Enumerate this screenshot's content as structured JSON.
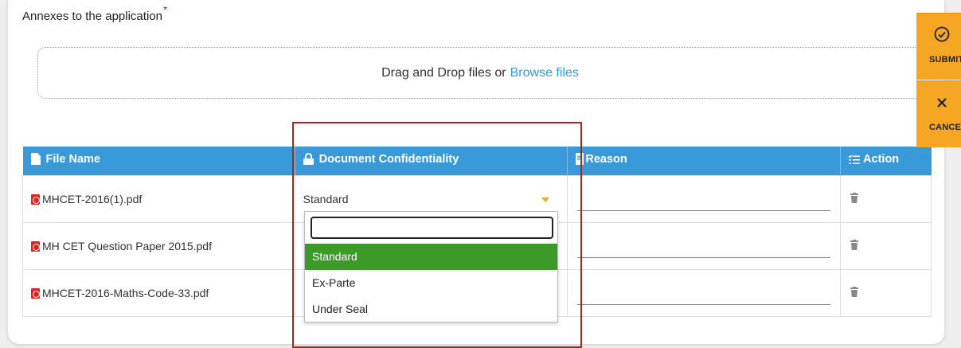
{
  "section": {
    "title": "Annexes to the application",
    "required_mark": "*"
  },
  "dropzone": {
    "text": "Drag and Drop files or",
    "browse_label": "Browse files"
  },
  "table": {
    "headers": {
      "file_name": "File Name",
      "confidentiality": "Document Confidentiality",
      "reason": "Reason",
      "action": "Action"
    },
    "rows": [
      {
        "file_name": "MHCET-2016(1).pdf",
        "confidentiality": "Standard",
        "reason": ""
      },
      {
        "file_name": "MH CET Question Paper 2015.pdf",
        "confidentiality": "",
        "reason": ""
      },
      {
        "file_name": "MHCET-2016-Maths-Code-33.pdf",
        "confidentiality": "",
        "reason": ""
      }
    ]
  },
  "dropdown": {
    "search_value": "",
    "options": [
      "Standard",
      "Ex-Parte",
      "Under Seal"
    ],
    "selected": "Standard"
  },
  "side_actions": {
    "submit_label": "SUBMIT",
    "cancel_label": "CANCEL"
  },
  "colors": {
    "header_bg": "#3a9ad9",
    "accent_orange": "#f5a623",
    "selected_green": "#3c9a29",
    "highlight_red": "#b02020",
    "link_blue": "#2d9cdb"
  },
  "icons": {
    "file_header": "file-icon",
    "confidentiality_header": "lock-icon",
    "reason_header": "document-icon",
    "action_header": "list-icon",
    "file_type": "pdf-icon",
    "row_action": "trash-icon",
    "submit": "check-circle-icon",
    "cancel": "close-icon"
  }
}
